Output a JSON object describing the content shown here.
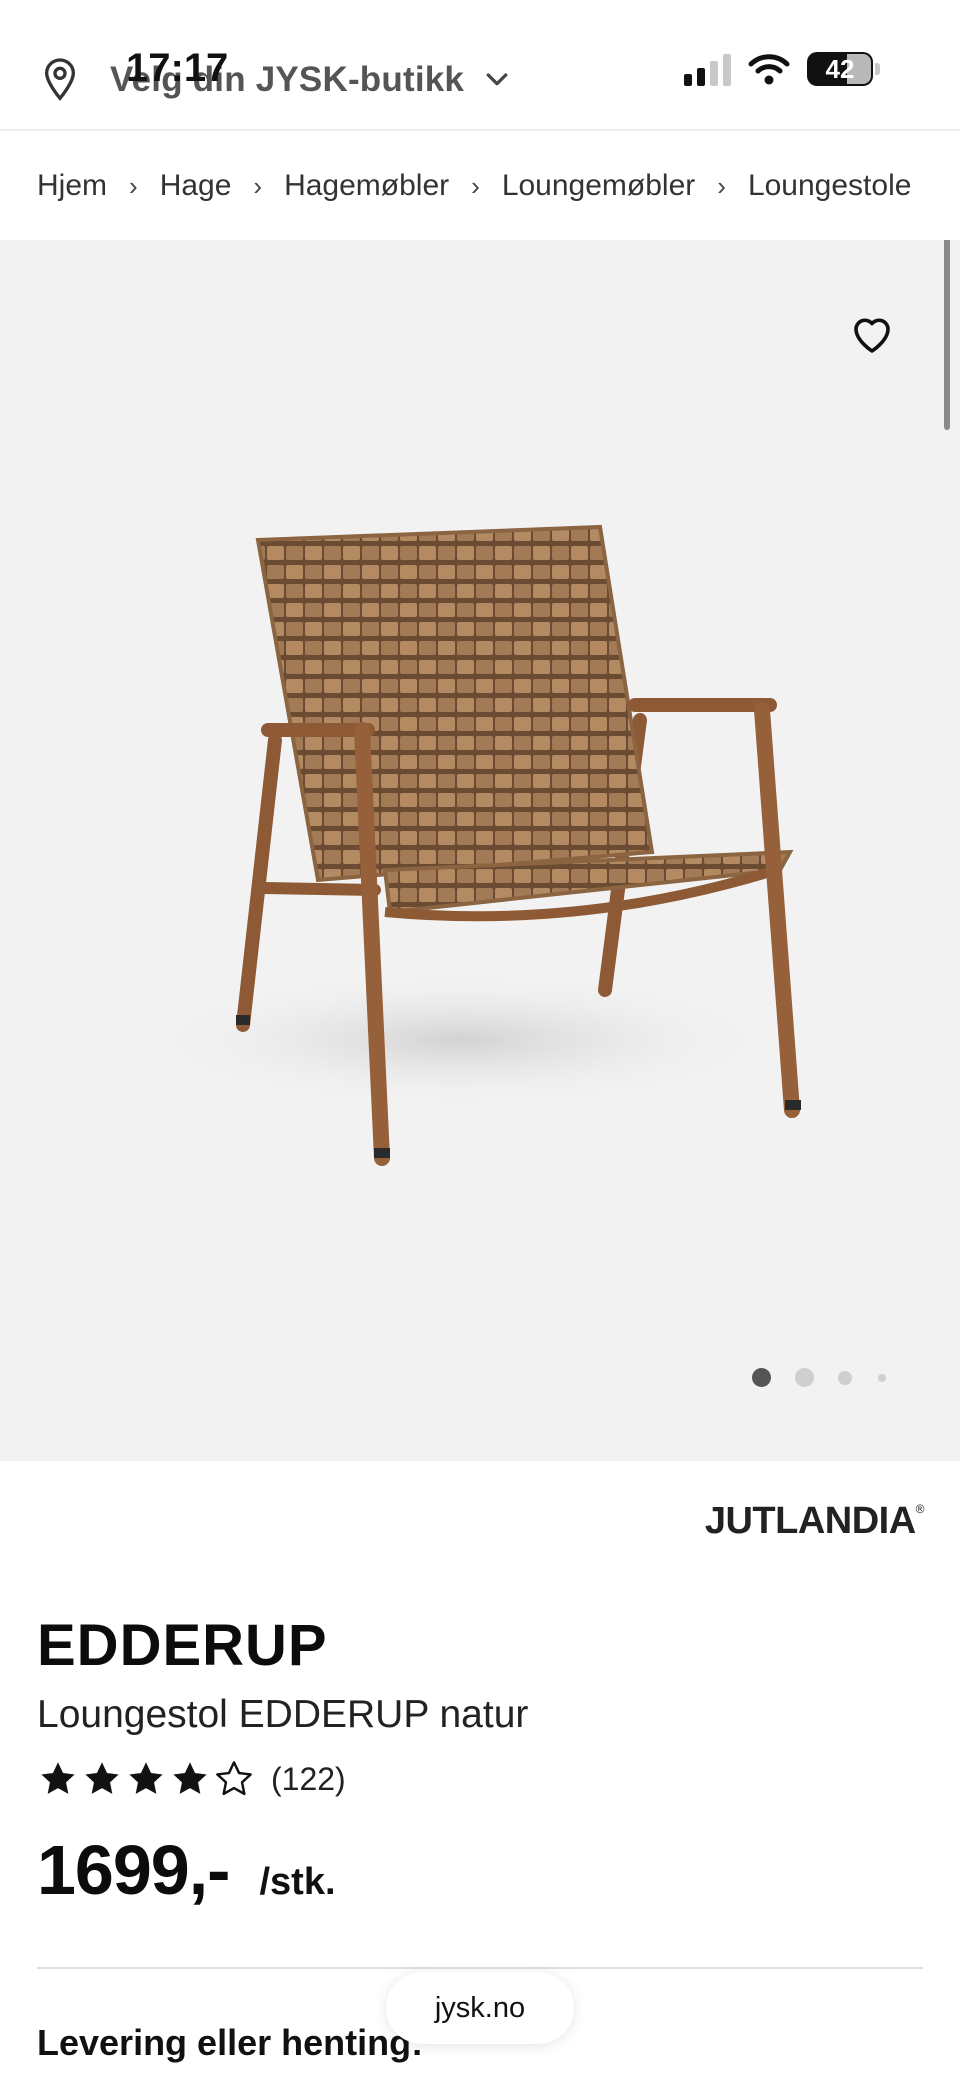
{
  "status_bar": {
    "time": "17:17",
    "battery": "42"
  },
  "header": {
    "store_label": "Velg din JYSK-butikk"
  },
  "breadcrumb": [
    "Hjem",
    "Hage",
    "Hagemøbler",
    "Loungemøbler",
    "Loungestole"
  ],
  "gallery": {
    "image_subject": "woven lounge chair, natural brown",
    "slide_count": 4,
    "active_slide": 1
  },
  "product": {
    "brand": "JUTLANDIA",
    "brand_mark": "®",
    "name": "EDDERUP",
    "description": "Loungestol EDDERUP natur",
    "rating_stars": 4,
    "rating_max": 5,
    "review_count": "(122)",
    "price": "1699,-",
    "price_unit": "/stk."
  },
  "delivery": {
    "heading": "Levering eller henting:"
  },
  "browser": {
    "url": "jysk.no"
  }
}
